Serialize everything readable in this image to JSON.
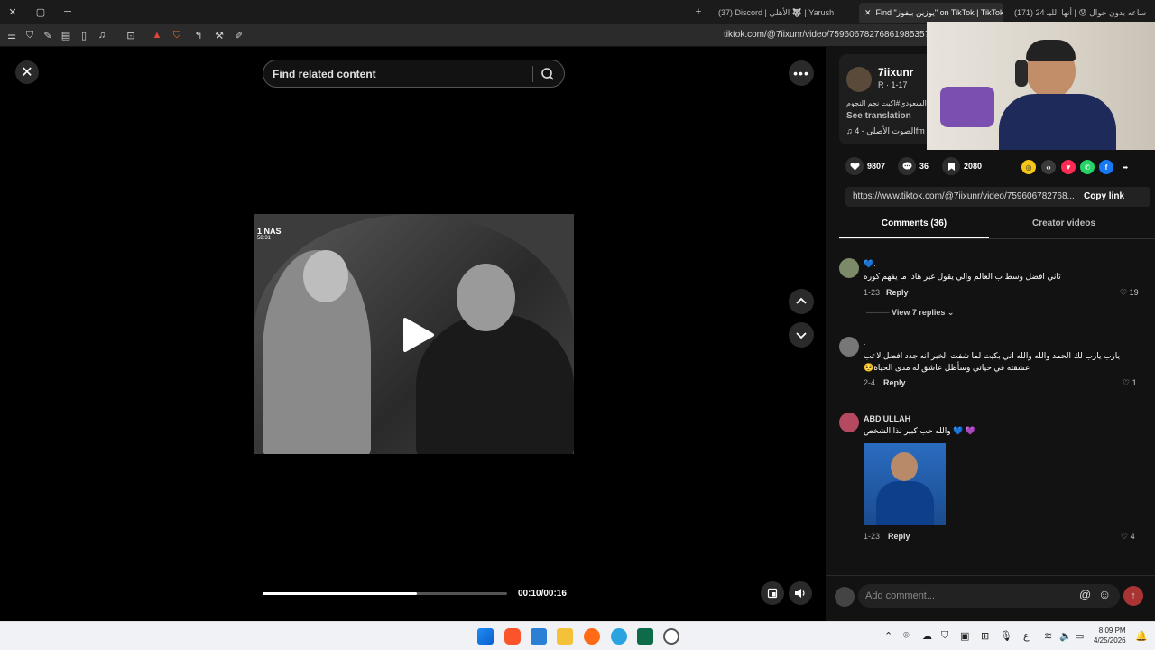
{
  "browser": {
    "tabs": [
      {
        "label": "(37) Discord | الأهلي 🐺 | Yarush"
      },
      {
        "label": "Find \"يوزين بيفوز\" on TikTok | TikTok",
        "active": true
      },
      {
        "label": "(171) 24 ساعه بدون جوال 😰 | أنها الليـ"
      }
    ],
    "url": "tiktok.com/@7iixunr/video/7596067827686198535?q="
  },
  "search": {
    "placeholder": "Find related content"
  },
  "video": {
    "badge_line1": "1 NAS",
    "badge_line2": "58:31",
    "elapsed": "00:10",
    "duration": "00:16",
    "time_text": "00:10/00:16",
    "progress": 0.63
  },
  "author": {
    "name": "7iixunr",
    "sub": "R · 1-17",
    "caption": "السعودي#اكبت نجم النجوم",
    "see_translation": "See translation",
    "music": "الصوت الأصلي - 4fm"
  },
  "actions": {
    "likes": "9807",
    "comments": "36",
    "saves": "2080"
  },
  "share": {
    "link": "https://www.tiktok.com/@7iixunr/video/759606782768...",
    "copy_label": "Copy link"
  },
  "tabs": {
    "comments": "Comments (36)",
    "creator": "Creator videos"
  },
  "comments": [
    {
      "user": "💙.",
      "text": "ثاني افضل وسط ب العالم والي يقول غير هاذا ما يفهم كوره",
      "date": "1-23",
      "reply": "Reply",
      "likes": "19",
      "view_replies": "View 7 replies"
    },
    {
      "user": ".",
      "text": "يارب يارب لك الحمد والله والله اني بكيت لما شفت الخبر انه جدد افضل لاعب عشقته في حياتي وسأظل عاشق له مدى الحياة🥺",
      "date": "2-4",
      "reply": "Reply",
      "likes": "1"
    },
    {
      "user": "ABD'ULLAH",
      "text": "💜 💙 والله حب كبير لذا الشخص",
      "date": "1-23",
      "reply": "Reply",
      "likes": "4"
    }
  ],
  "add_comment": {
    "placeholder": "Add comment..."
  },
  "taskbar": {
    "time": "8:09 PM",
    "date": "4/25/2026"
  },
  "colors": {
    "accent": "#fe2c55",
    "panel": "#121212"
  }
}
